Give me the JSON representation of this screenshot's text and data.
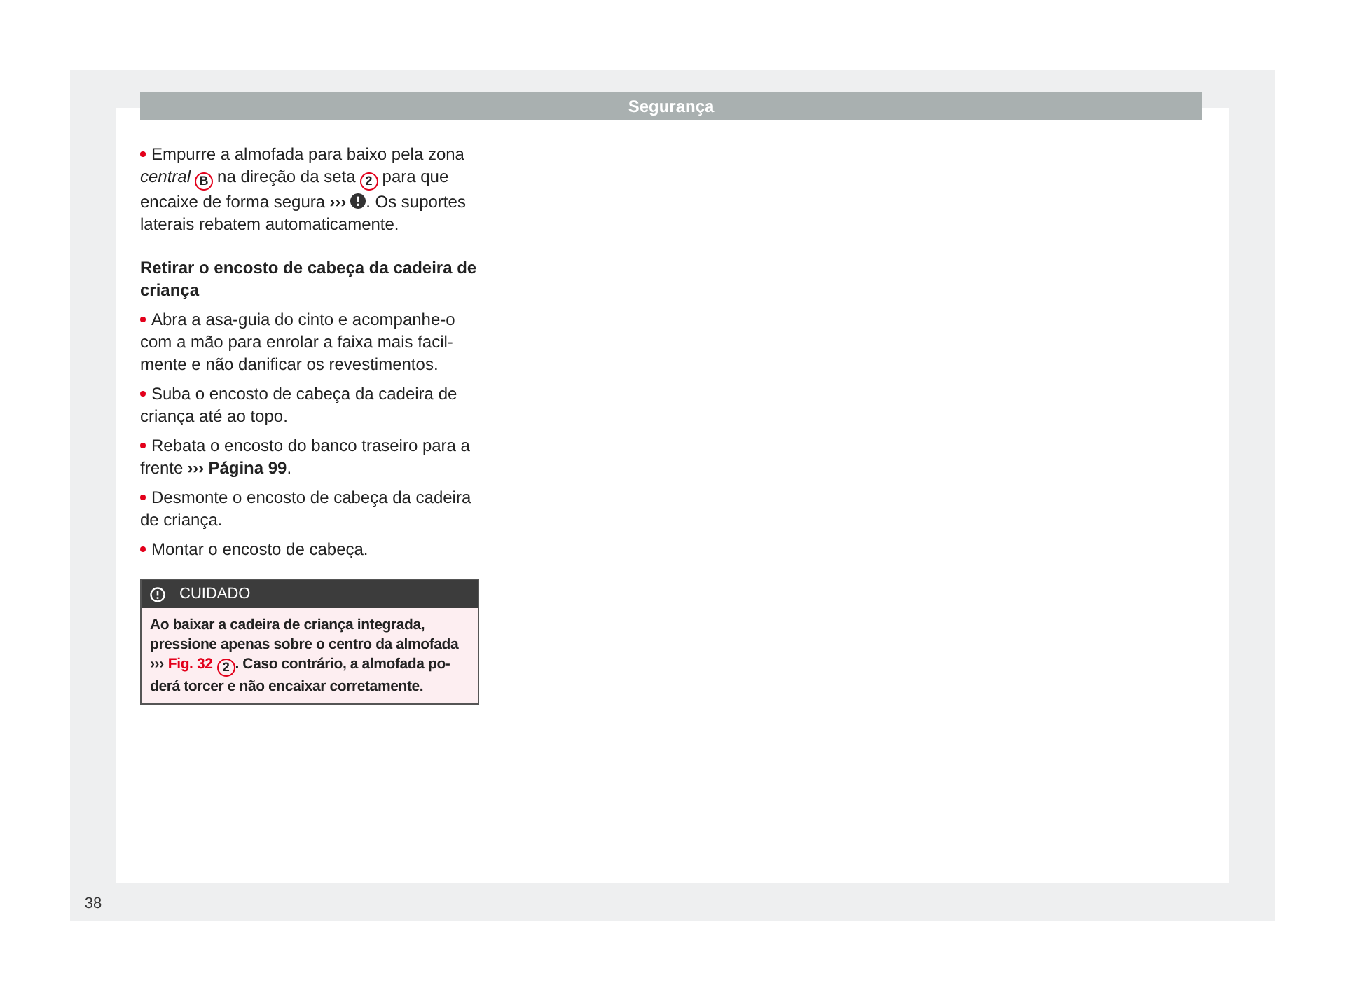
{
  "header": {
    "title": "Segurança"
  },
  "blocks": [
    {
      "kind": "bullet",
      "lines": [
        [
          {
            "kind": "text",
            "s": "Empurre a almofada para baixo pela zona"
          }
        ],
        [
          {
            "kind": "italic",
            "s": "central"
          },
          {
            "kind": "marker",
            "s": "B"
          },
          {
            "kind": "text",
            "s": "na direção da seta"
          },
          {
            "kind": "marker",
            "s": "2"
          },
          {
            "kind": "text",
            "s": "para que"
          }
        ],
        [
          {
            "kind": "text",
            "s": "encaixe de forma segura"
          },
          {
            "kind": "arrow",
            "s": "›››"
          },
          {
            "kind": "warn"
          },
          {
            "kind": "text",
            "s": ". Os suportes"
          }
        ],
        [
          {
            "kind": "text",
            "s": "laterais rebatem automaticamente."
          }
        ]
      ]
    },
    {
      "kind": "heading",
      "lines": [
        [
          {
            "kind": "text",
            "s": "Retirar o encosto de cabeça da cadeira de"
          }
        ],
        [
          {
            "kind": "text",
            "s": "criança"
          }
        ]
      ]
    },
    {
      "kind": "bullet",
      "lines": [
        [
          {
            "kind": "text",
            "s": "Abra a asa-guia do cinto e acompanhe-o"
          }
        ],
        [
          {
            "kind": "text",
            "s": "com a mão para enrolar a faixa mais facil-"
          }
        ],
        [
          {
            "kind": "text",
            "s": "mente e não danificar os revestimentos."
          }
        ]
      ]
    },
    {
      "kind": "bullet",
      "lines": [
        [
          {
            "kind": "text",
            "s": "Suba o encosto de cabeça da cadeira de"
          }
        ],
        [
          {
            "kind": "text",
            "s": "criança até ao topo."
          }
        ]
      ]
    },
    {
      "kind": "bullet",
      "lines": [
        [
          {
            "kind": "text",
            "s": "Rebata o encosto do banco traseiro para a"
          }
        ],
        [
          {
            "kind": "text",
            "s": "frente"
          },
          {
            "kind": "arrow",
            "s": "›››"
          },
          {
            "kind": "bold",
            "s": "Página 99"
          },
          {
            "kind": "text",
            "s": "."
          }
        ]
      ]
    },
    {
      "kind": "bullet",
      "lines": [
        [
          {
            "kind": "text",
            "s": "Desmonte o encosto de cabeça da cadeira"
          }
        ],
        [
          {
            "kind": "text",
            "s": "de criança."
          }
        ]
      ]
    },
    {
      "kind": "bullet",
      "lines": [
        [
          {
            "kind": "text",
            "s": "Montar o encosto de cabeça."
          }
        ]
      ]
    }
  ],
  "notice": {
    "title": "CUIDADO",
    "lines": [
      [
        {
          "kind": "text",
          "s": "Ao baixar a cadeira de criança integrada,"
        }
      ],
      [
        {
          "kind": "text",
          "s": "pressione apenas sobre o centro da almofada"
        }
      ],
      [
        {
          "kind": "arrow",
          "s": "›››"
        },
        {
          "kind": "ref",
          "s": "Fig. 32"
        },
        {
          "kind": "marker",
          "s": "2"
        },
        {
          "kind": "text",
          "s": ". Caso contrário, a almofada po-"
        }
      ],
      [
        {
          "kind": "text",
          "s": "derá torcer e não encaixar corretamente."
        }
      ]
    ]
  },
  "page_number": "38"
}
